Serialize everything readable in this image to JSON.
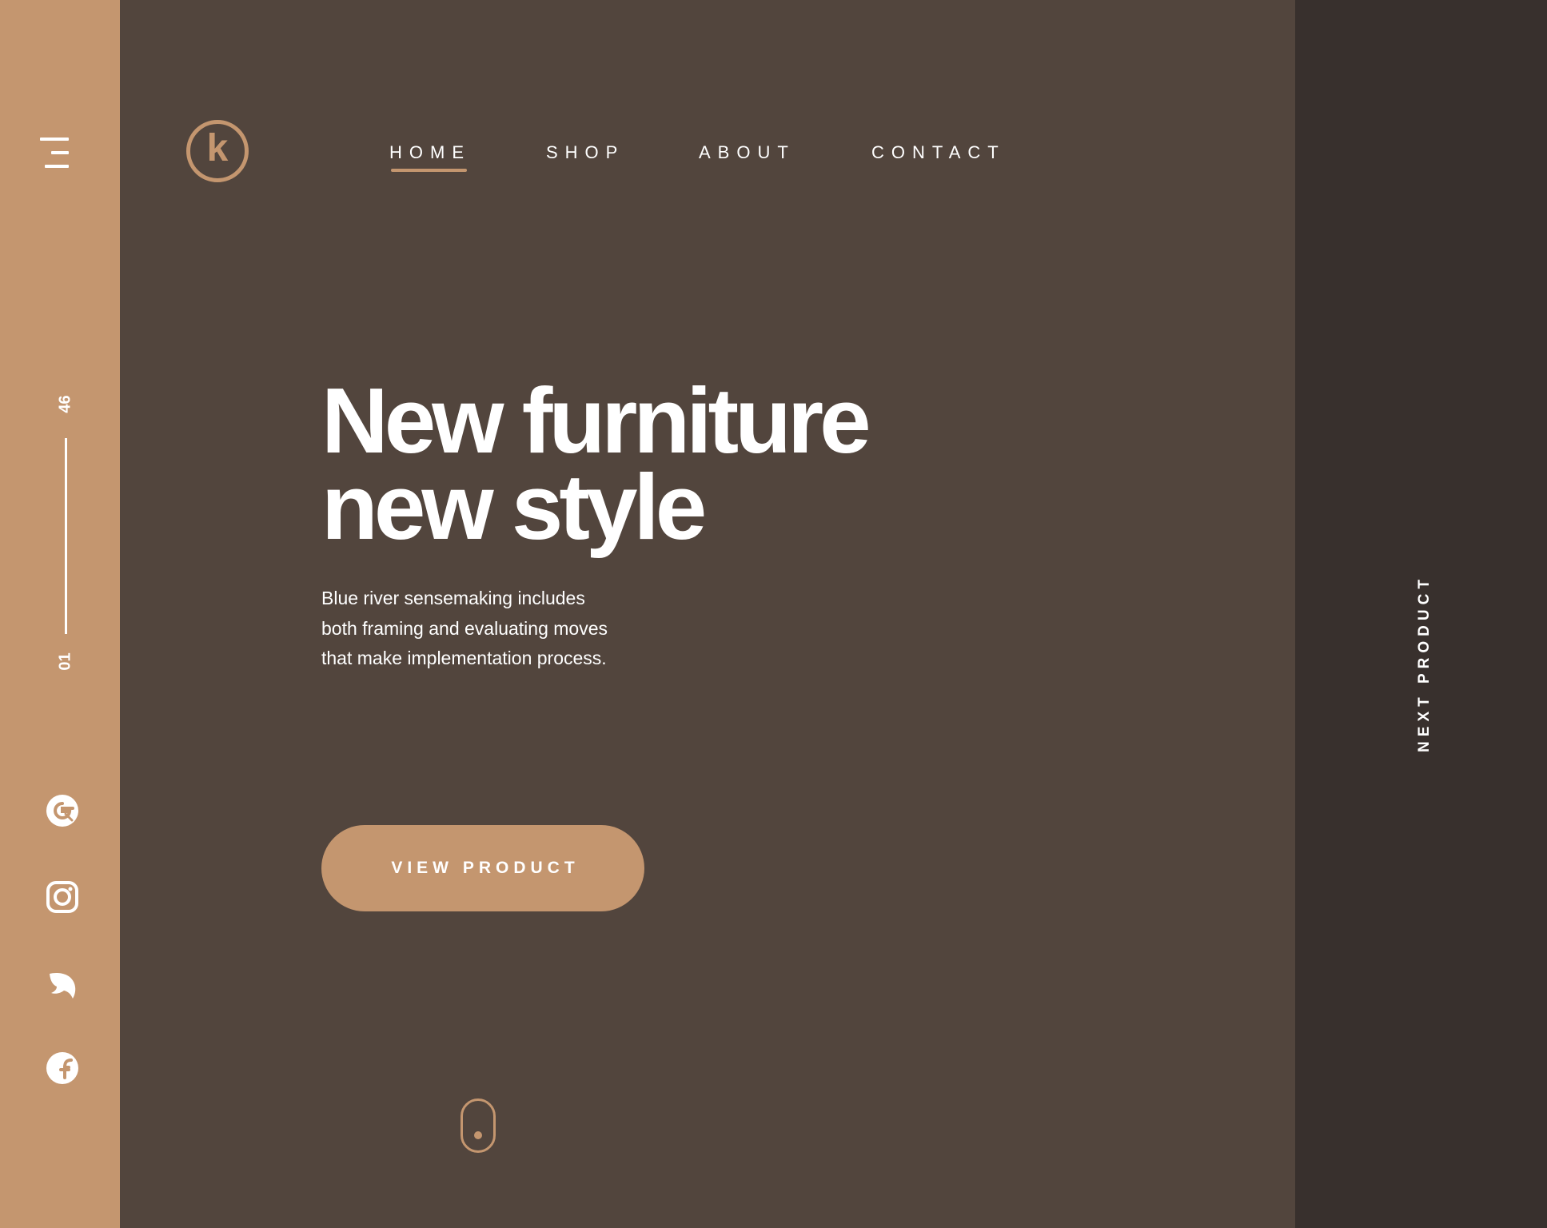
{
  "brand": {
    "logo_letter": "k"
  },
  "nav": {
    "items": [
      {
        "label": "HOME",
        "active": true
      },
      {
        "label": "SHOP",
        "active": false
      },
      {
        "label": "ABOUT",
        "active": false
      },
      {
        "label": "CONTACT",
        "active": false
      }
    ]
  },
  "sidebar": {
    "menu_icon": "hamburger-menu-icon",
    "counter": {
      "current": "01",
      "total": "46"
    },
    "social_icons": [
      "dribbble-icon",
      "instagram-icon",
      "twitter-icon",
      "facebook-icon"
    ]
  },
  "hero": {
    "title_line1": "New furniture",
    "title_line2": "new style",
    "description_line1": "Blue river sensemaking includes",
    "description_line2": "both framing and evaluating moves",
    "description_line3": "that make implementation process.",
    "cta_label": "VIEW PRODUCT",
    "scroll_icon": "mouse-scroll-icon"
  },
  "right_panel": {
    "next_label": "NEXT PRODUCT"
  },
  "colors": {
    "accent": "#c4966f",
    "main_bg": "#52453d",
    "right_panel_bg": "#38302d",
    "text": "#ffffff"
  }
}
